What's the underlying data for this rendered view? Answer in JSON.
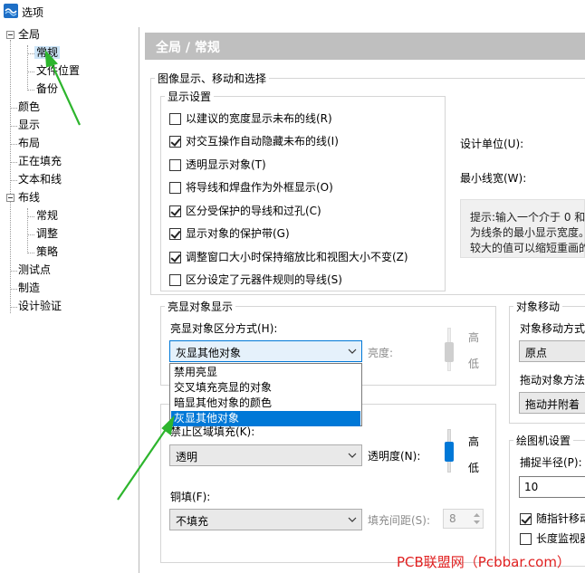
{
  "window": {
    "title": "选项"
  },
  "tree": {
    "items": [
      {
        "label": "全局",
        "level": 0,
        "expanded": true
      },
      {
        "label": "常规",
        "level": 1,
        "selected": true
      },
      {
        "label": "文件位置",
        "level": 1
      },
      {
        "label": "备份",
        "level": 1
      },
      {
        "label": "颜色",
        "level": 0
      },
      {
        "label": "显示",
        "level": 0
      },
      {
        "label": "布局",
        "level": 0
      },
      {
        "label": "正在填充",
        "level": 0
      },
      {
        "label": "文本和线",
        "level": 0
      },
      {
        "label": "布线",
        "level": 0,
        "expanded": true
      },
      {
        "label": "常规",
        "level": 1
      },
      {
        "label": "调整",
        "level": 1
      },
      {
        "label": "策略",
        "level": 1
      },
      {
        "label": "测试点",
        "level": 0
      },
      {
        "label": "制造",
        "level": 0
      },
      {
        "label": "设计验证",
        "level": 0
      }
    ]
  },
  "header": {
    "title": "全局 / 常规"
  },
  "image_group": {
    "label": "图像显示、移动和选择",
    "display_settings": {
      "label": "显示设置",
      "checkboxes": [
        {
          "label": "以建议的宽度显示未布的线(R)",
          "checked": false
        },
        {
          "label": "对交互操作自动隐藏未布的线(I)",
          "checked": true
        },
        {
          "label": "透明显示对象(T)",
          "checked": false
        },
        {
          "label": "将导线和焊盘作为外框显示(O)",
          "checked": false
        },
        {
          "label": "区分受保护的导线和过孔(C)",
          "checked": true
        },
        {
          "label": "显示对象的保护带(G)",
          "checked": true
        },
        {
          "label": "调整窗口大小时保持缩放比和视图大小不变(Z)",
          "checked": true
        },
        {
          "label": "区分设定了元器件规则的导线(S)",
          "checked": false
        }
      ]
    },
    "design_units_label": "设计单位(U):",
    "min_line_width_label": "最小线宽(W):",
    "hint_lines": [
      "提示:输入一个介于 0 和",
      "为线条的最小显示宽度。",
      "较大的值可以缩短重画的"
    ]
  },
  "highlight_group": {
    "label": "亮显对象显示",
    "mode_label": "亮显对象区分方式(H):",
    "mode_value": "灰显其他对象",
    "brightness_label": "亮度:",
    "high_label": "高",
    "low_label": "低",
    "options": [
      "禁用亮显",
      "交叉填充亮显的对象",
      "暗显其他对象的颜色",
      "灰显其他对象"
    ]
  },
  "keepout_group": {
    "fill_label": "禁止区域填充(K):",
    "fill_value": "透明",
    "transparency_label": "透明度(N):",
    "high_label": "高",
    "low_label": "低",
    "copper_label": "铜填(F):",
    "copper_value": "不填充",
    "fill_spacing_label": "填充间距(S):",
    "fill_spacing_value": "8"
  },
  "move_group": {
    "label": "对象移动",
    "method_label": "对象移动方式",
    "method_value": "原点",
    "drag_label": "拖动对象方法",
    "drag_value": "拖动并附着"
  },
  "drawing_group": {
    "label": "绘图机设置",
    "capture_radius_label": "捕捉半径(P):",
    "capture_radius_value": "10",
    "follow_pointer_label": "随指针移动",
    "follow_pointer_checked": true,
    "length_monitor_label": "长度监视器",
    "length_monitor_checked": false
  },
  "watermark": "PCB联盟网（Pcbbar.com）",
  "colors": {
    "header_bg": "#bfbfbf",
    "selection": "#0078d7",
    "annotation_arrow": "#2db52d",
    "watermark": "#e02020"
  }
}
